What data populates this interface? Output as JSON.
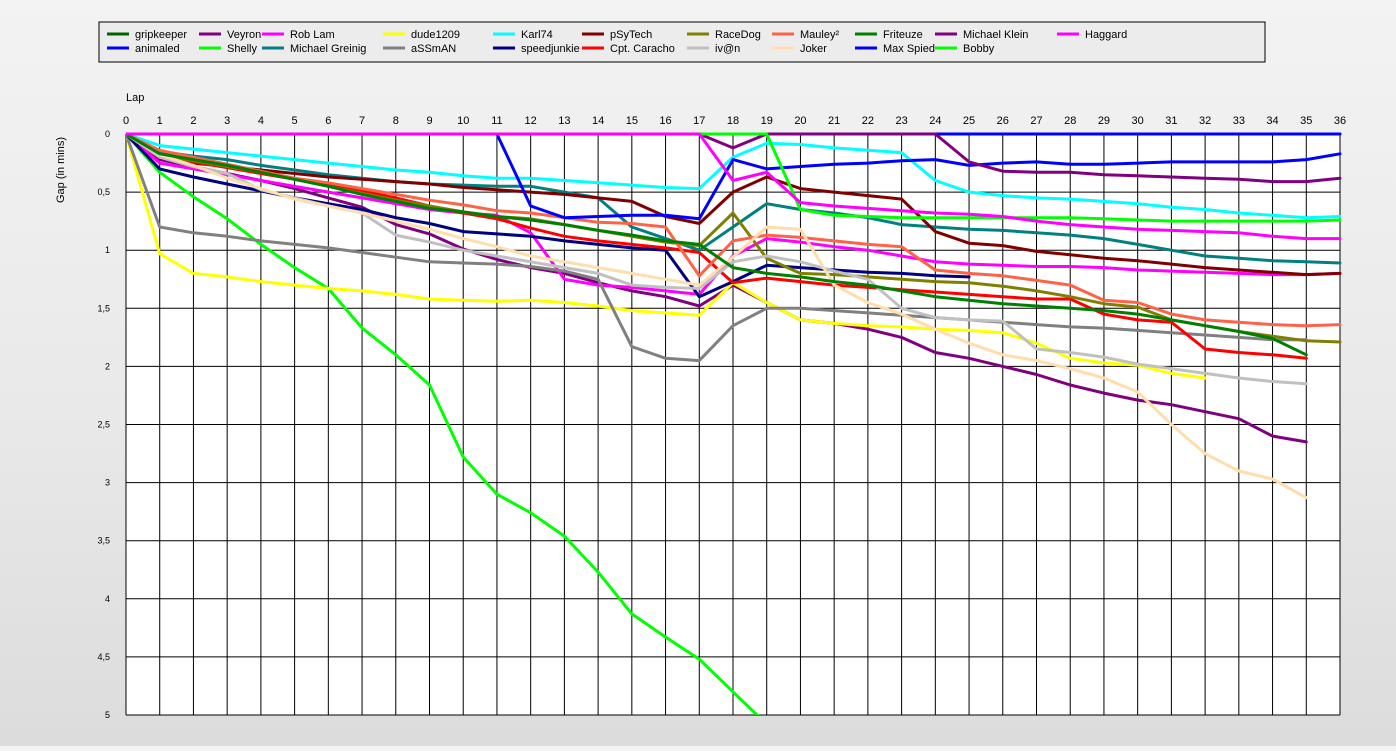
{
  "chart_data": {
    "type": "line",
    "title": "",
    "xlabel": "Lap",
    "ylabel": "Gap (in mins)",
    "x": [
      0,
      1,
      2,
      3,
      4,
      5,
      6,
      7,
      8,
      9,
      10,
      11,
      12,
      13,
      14,
      15,
      16,
      17,
      18,
      19,
      20,
      21,
      22,
      23,
      24,
      25,
      26,
      27,
      28,
      29,
      30,
      31,
      32,
      33,
      34,
      35,
      36
    ],
    "x_ticks": [
      "0",
      "1",
      "2",
      "3",
      "4",
      "5",
      "6",
      "7",
      "8",
      "9",
      "10",
      "11",
      "12",
      "13",
      "14",
      "15",
      "16",
      "17",
      "18",
      "19",
      "20",
      "21",
      "22",
      "23",
      "24",
      "25",
      "26",
      "27",
      "28",
      "29",
      "30",
      "31",
      "32",
      "33",
      "34",
      "35",
      "36"
    ],
    "y_ticks": [
      "0",
      "0,5",
      "1",
      "1,5",
      "2",
      "2,5",
      "3",
      "3,5",
      "4",
      "4,5",
      "5"
    ],
    "y_tick_values": [
      0,
      0.5,
      1,
      1.5,
      2,
      2.5,
      3,
      3.5,
      4,
      4.5,
      5
    ],
    "xlim": [
      0,
      36
    ],
    "ylim": [
      0,
      5
    ],
    "y_inverted": true,
    "grid": true,
    "legend_position": "top",
    "series": [
      {
        "name": "gripkeeper",
        "color": "#006400",
        "values": [
          0,
          0,
          0,
          0,
          0,
          0,
          0,
          0,
          0,
          0,
          0,
          0,
          0,
          0,
          0,
          0,
          0,
          0,
          0,
          0,
          0,
          0,
          0,
          0,
          0,
          0,
          0,
          0,
          0,
          0,
          0,
          0,
          0,
          0,
          0,
          0,
          0
        ]
      },
      {
        "name": "animaled",
        "color": "#0000ff",
        "values": [
          0,
          0,
          0,
          0,
          0,
          0,
          0,
          0,
          0,
          0,
          0,
          0,
          0,
          0,
          0,
          0,
          0,
          0,
          0,
          0,
          0,
          0,
          0,
          0,
          0,
          0,
          0,
          0,
          0,
          0,
          0,
          0,
          0,
          0,
          0,
          0,
          0
        ]
      },
      {
        "name": "Veyron",
        "color": "#800080",
        "values": [
          0,
          0.22,
          0.28,
          0.34,
          0.4,
          0.47,
          0.55,
          0.63,
          0.78,
          0.86,
          0.99,
          1.08,
          1.15,
          1.2,
          1.28,
          1.35,
          1.4,
          1.48,
          1.3,
          1.45,
          1.6,
          1.63,
          1.68,
          1.75,
          1.88,
          1.93,
          2.0,
          2.07,
          2.16,
          2.23,
          2.29,
          2.33,
          2.39,
          2.45,
          2.6,
          2.65,
          null
        ]
      },
      {
        "name": "Shelly",
        "color": "#00ff00",
        "values": [
          0,
          0.33,
          0.54,
          0.73,
          0.95,
          1.15,
          1.33,
          1.67,
          1.9,
          2.16,
          2.78,
          3.1,
          3.26,
          3.46,
          3.77,
          4.13,
          4.33,
          4.52,
          4.8,
          5.08,
          null,
          null,
          null,
          null,
          null,
          null,
          null,
          null,
          null,
          null,
          null,
          null,
          null,
          null,
          null,
          null,
          null
        ]
      },
      {
        "name": "Rob Lam",
        "color": "#ff00ff",
        "values": [
          0,
          0.25,
          0.3,
          0.35,
          0.4,
          0.45,
          0.5,
          0.55,
          0.6,
          0.65,
          0.68,
          0.7,
          0.85,
          1.25,
          1.3,
          1.32,
          1.35,
          1.38,
          1.05,
          0.9,
          0.93,
          0.97,
          1.0,
          1.05,
          1.1,
          1.12,
          1.13,
          1.14,
          1.14,
          1.15,
          1.17,
          1.18,
          1.19,
          1.2,
          1.21,
          1.21,
          1.2
        ]
      },
      {
        "name": "Michael Greinig",
        "color": "#008080",
        "values": [
          0,
          0.15,
          0.19,
          0.22,
          0.27,
          0.31,
          0.35,
          0.38,
          0.41,
          0.43,
          0.44,
          0.45,
          0.45,
          0.5,
          0.55,
          0.8,
          0.9,
          1.0,
          0.8,
          0.6,
          0.65,
          0.68,
          0.72,
          0.78,
          0.8,
          0.82,
          0.83,
          0.85,
          0.87,
          0.9,
          0.95,
          1.0,
          1.05,
          1.07,
          1.09,
          1.1,
          1.11
        ]
      },
      {
        "name": "dude1209",
        "color": "#ffff00",
        "values": [
          0,
          1.03,
          1.2,
          1.23,
          1.27,
          1.3,
          1.33,
          1.35,
          1.38,
          1.42,
          1.43,
          1.44,
          1.43,
          1.45,
          1.48,
          1.52,
          1.54,
          1.56,
          1.28,
          1.45,
          1.6,
          1.63,
          1.65,
          1.66,
          1.68,
          1.69,
          1.71,
          1.8,
          1.93,
          1.97,
          1.99,
          2.06,
          2.1,
          null,
          null,
          null,
          null
        ]
      },
      {
        "name": "aSSmAN",
        "color": "#808080",
        "values": [
          0,
          0.8,
          0.85,
          0.88,
          0.92,
          0.95,
          0.98,
          1.02,
          1.06,
          1.1,
          1.11,
          1.12,
          1.14,
          1.18,
          1.25,
          1.83,
          1.93,
          1.95,
          1.65,
          1.5,
          1.5,
          1.52,
          1.54,
          1.56,
          1.58,
          1.6,
          1.62,
          1.64,
          1.66,
          1.67,
          1.69,
          1.71,
          1.73,
          1.75,
          1.77,
          1.77,
          null
        ]
      },
      {
        "name": "Karl74",
        "color": "#00ffff",
        "values": [
          0,
          0.1,
          0.13,
          0.16,
          0.19,
          0.22,
          0.25,
          0.28,
          0.31,
          0.33,
          0.36,
          0.38,
          0.38,
          0.4,
          0.42,
          0.44,
          0.46,
          0.47,
          0.2,
          0.08,
          0.09,
          0.12,
          0.14,
          0.16,
          0.4,
          0.5,
          0.53,
          0.55,
          0.56,
          0.58,
          0.6,
          0.63,
          0.65,
          0.68,
          0.7,
          0.72,
          0.71
        ]
      },
      {
        "name": "speedjunkie",
        "color": "#000080",
        "values": [
          0,
          0.3,
          0.37,
          0.43,
          0.49,
          0.55,
          0.6,
          0.65,
          0.72,
          0.77,
          0.84,
          0.86,
          0.88,
          0.92,
          0.95,
          0.98,
          1.0,
          1.4,
          1.27,
          1.13,
          1.15,
          1.17,
          1.19,
          1.2,
          1.22,
          1.23,
          null,
          null,
          null,
          null,
          null,
          null,
          null,
          null,
          null,
          null,
          null
        ]
      },
      {
        "name": "pSyTech",
        "color": "#800000",
        "values": [
          0,
          0.2,
          0.25,
          0.28,
          0.31,
          0.34,
          0.37,
          0.39,
          0.41,
          0.43,
          0.46,
          0.48,
          0.5,
          0.52,
          0.55,
          0.58,
          0.71,
          0.77,
          0.5,
          0.37,
          0.47,
          0.5,
          0.53,
          0.56,
          0.84,
          0.94,
          0.96,
          1.01,
          1.04,
          1.07,
          1.09,
          1.12,
          1.15,
          1.17,
          1.19,
          1.21,
          1.2
        ]
      },
      {
        "name": "Cpt. Caracho",
        "color": "#ff0000",
        "values": [
          0,
          0.2,
          0.24,
          0.29,
          0.34,
          0.39,
          0.44,
          0.49,
          0.55,
          0.62,
          0.68,
          0.73,
          0.81,
          0.88,
          0.92,
          0.95,
          0.98,
          1.02,
          1.28,
          1.24,
          1.27,
          1.3,
          1.32,
          1.34,
          1.36,
          1.38,
          1.4,
          1.42,
          1.42,
          1.55,
          1.6,
          1.62,
          1.85,
          1.88,
          1.9,
          1.93,
          null
        ]
      },
      {
        "name": "RaceDog",
        "color": "#808000",
        "values": [
          0,
          0.18,
          0.23,
          0.28,
          0.33,
          0.39,
          0.45,
          0.51,
          0.57,
          0.62,
          0.67,
          0.71,
          0.73,
          0.78,
          0.83,
          0.88,
          0.93,
          0.96,
          0.68,
          1.07,
          1.2,
          1.21,
          1.23,
          1.25,
          1.27,
          1.28,
          1.31,
          1.35,
          1.4,
          1.46,
          1.49,
          1.6,
          1.65,
          1.7,
          1.74,
          1.78,
          1.79
        ]
      },
      {
        "name": "iv@n",
        "color": "#c0c0c0",
        "values": [
          0,
          0.2,
          0.28,
          0.34,
          0.48,
          0.55,
          0.62,
          0.68,
          0.87,
          0.93,
          1.0,
          1.05,
          1.1,
          1.15,
          1.2,
          1.3,
          1.32,
          1.33,
          1.1,
          1.05,
          1.1,
          1.18,
          1.25,
          1.5,
          1.58,
          1.6,
          1.61,
          1.85,
          1.88,
          1.92,
          1.98,
          2.02,
          2.06,
          2.1,
          2.13,
          2.15,
          null
        ]
      },
      {
        "name": "Mauley²",
        "color": "#ff6347",
        "values": [
          0,
          0.14,
          0.2,
          0.26,
          0.32,
          0.38,
          0.42,
          0.47,
          0.52,
          0.57,
          0.61,
          0.66,
          0.68,
          0.72,
          0.76,
          0.77,
          0.8,
          1.22,
          0.92,
          0.87,
          0.89,
          0.92,
          0.95,
          0.97,
          1.17,
          1.2,
          1.22,
          1.26,
          1.3,
          1.43,
          1.45,
          1.55,
          1.6,
          1.62,
          1.64,
          1.65,
          1.64
        ]
      },
      {
        "name": "Joker",
        "color": "#ffdead",
        "values": [
          0,
          0.18,
          0.27,
          0.38,
          0.47,
          0.56,
          0.62,
          0.68,
          0.75,
          0.82,
          0.9,
          0.97,
          1.05,
          1.1,
          1.15,
          1.2,
          1.25,
          1.3,
          1.06,
          0.8,
          0.82,
          1.3,
          1.45,
          1.55,
          1.68,
          1.8,
          1.9,
          1.95,
          2.02,
          2.1,
          2.22,
          2.5,
          2.75,
          2.9,
          2.97,
          3.13,
          null
        ]
      },
      {
        "name": "Friteuze",
        "color": "#008000",
        "values": [
          0,
          0.17,
          0.22,
          0.27,
          0.33,
          0.39,
          0.45,
          0.52,
          0.58,
          0.64,
          0.67,
          0.71,
          0.74,
          0.78,
          0.83,
          0.87,
          0.92,
          0.95,
          1.15,
          1.2,
          1.23,
          1.27,
          1.3,
          1.35,
          1.4,
          1.43,
          1.46,
          1.48,
          1.5,
          1.52,
          1.55,
          1.6,
          1.65,
          1.7,
          1.76,
          1.9,
          null
        ]
      },
      {
        "name": "Max Spied",
        "color": "#0000ff",
        "values": [
          0,
          0,
          0,
          0,
          0,
          0,
          0,
          0,
          0,
          0,
          0,
          0,
          0.62,
          0.72,
          0.71,
          0.7,
          0.7,
          0.73,
          0.22,
          0.3,
          0.28,
          0.26,
          0.25,
          0.23,
          0.22,
          0.27,
          0.25,
          0.24,
          0.26,
          0.26,
          0.25,
          0.24,
          0.24,
          0.24,
          0.24,
          0.22,
          0.17
        ]
      },
      {
        "name": "Michael Klein",
        "color": "#800080",
        "values": [
          0,
          0,
          0,
          0,
          0,
          0,
          0,
          0,
          0,
          0,
          0,
          0,
          0,
          0,
          0,
          0,
          0,
          0,
          0.12,
          0,
          0,
          0,
          0,
          0,
          0,
          0.24,
          0.32,
          0.33,
          0.33,
          0.35,
          0.36,
          0.37,
          0.38,
          0.39,
          0.41,
          0.41,
          0.38
        ]
      },
      {
        "name": "Bobby",
        "color": "#00ff00",
        "values": [
          0,
          0,
          0,
          0,
          0,
          0,
          0,
          0,
          0,
          0,
          0,
          0,
          0,
          0,
          0,
          0,
          0,
          0,
          0,
          0,
          0.65,
          0.7,
          0.71,
          0.72,
          0.72,
          0.72,
          0.72,
          0.72,
          0.72,
          0.73,
          0.74,
          0.75,
          0.75,
          0.75,
          0.75,
          0.75,
          0.74
        ]
      },
      {
        "name": "Haggard",
        "color": "#ff00ff",
        "values": [
          0,
          0,
          0,
          0,
          0,
          0,
          0,
          0,
          0,
          0,
          0,
          0,
          0,
          0,
          0,
          0,
          0,
          0,
          0.4,
          0.33,
          0.59,
          0.62,
          0.64,
          0.66,
          0.68,
          0.69,
          0.71,
          0.75,
          0.78,
          0.8,
          0.82,
          0.83,
          0.84,
          0.85,
          0.88,
          0.9,
          0.9
        ]
      }
    ]
  }
}
